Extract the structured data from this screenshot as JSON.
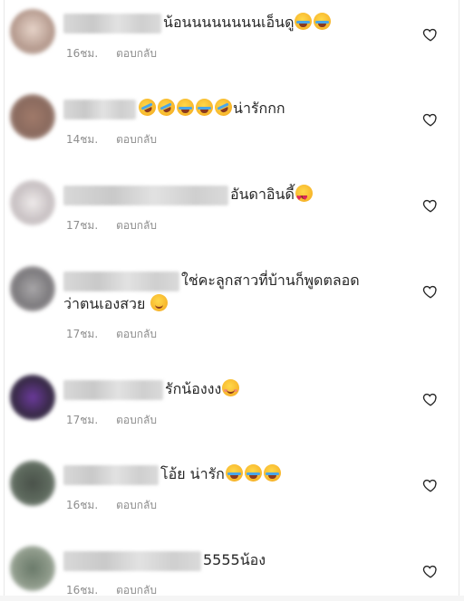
{
  "comments": [
    {
      "text": "น้อนนนนนนนนเอ็นดู",
      "emojis": [
        "face-with-tears-of-joy",
        "face-with-tears-of-joy"
      ],
      "time": "16ชม.",
      "reply": "ตอบกลับ",
      "avatar_color": "#b59a8e"
    },
    {
      "text": "น่ารักกก",
      "emojis": [
        "rolling-on-floor-laughing",
        "rolling-on-floor-laughing",
        "face-with-tears-of-joy",
        "face-with-tears-of-joy",
        "rolling-on-floor-laughing"
      ],
      "time": "14ชม.",
      "reply": "ตอบกลับ",
      "avatar_color": "#8a6a5e"
    },
    {
      "text": "อันดาอินดี้",
      "emojis": [
        "smiling-face-with-heart-eyes"
      ],
      "time": "17ชม.",
      "reply": "ตอบกลับ",
      "avatar_color": "#c9c2c4"
    },
    {
      "text": "ใช่คะลูกสาวที่บ้านก็พูดตลอด",
      "text_line2": "ว่าตนเองสวย",
      "emojis": [
        "smiling-face"
      ],
      "time": "17ชม.",
      "reply": "ตอบกลับ",
      "avatar_color": "#7d7b7e"
    },
    {
      "text": "รักน้องงง",
      "emojis": [
        "relieved-face"
      ],
      "time": "17ชม.",
      "reply": "ตอบกลับ",
      "avatar_color": "#3a2a4a"
    },
    {
      "text": "โอ้ย น่ารัก",
      "emojis": [
        "face-with-tears-of-joy",
        "face-with-tears-of-joy",
        "face-with-tears-of-joy"
      ],
      "time": "16ชม.",
      "reply": "ตอบกลับ",
      "avatar_color": "#5e6a5e"
    },
    {
      "text": "5555น้อง",
      "emojis": [],
      "time": "16ชม.",
      "reply": "ตอบกลับ",
      "avatar_color": "#8e9a8a"
    }
  ],
  "icons": {
    "like": "heart-outline-icon"
  },
  "colors": {
    "text": "#262626",
    "meta": "#8e8e8e",
    "emoji": "#f7b52a"
  }
}
